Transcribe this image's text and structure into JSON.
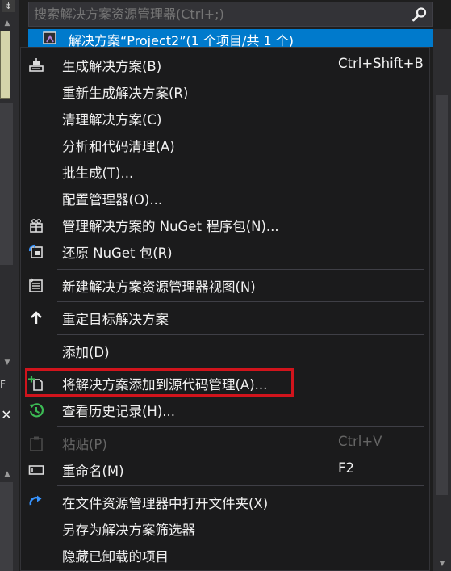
{
  "search": {
    "placeholder": "搜索解决方案资源管理器(Ctrl+;)"
  },
  "solution_row": {
    "label": "解决方案“Project2”(1 个项目/共 1 个)"
  },
  "left_strip": {
    "letter": "F"
  },
  "menu": {
    "items": [
      {
        "label": "生成解决方案(B)",
        "shortcut": "Ctrl+Shift+B",
        "icon": "build-icon"
      },
      {
        "label": "重新生成解决方案(R)",
        "shortcut": "",
        "icon": ""
      },
      {
        "label": "清理解决方案(C)",
        "shortcut": "",
        "icon": ""
      },
      {
        "label": "分析和代码清理(A)",
        "shortcut": "",
        "icon": ""
      },
      {
        "label": "批生成(T)...",
        "shortcut": "",
        "icon": ""
      },
      {
        "label": "配置管理器(O)...",
        "shortcut": "",
        "icon": ""
      },
      {
        "label": "管理解决方案的 NuGet 程序包(N)...",
        "shortcut": "",
        "icon": "nuget-package-icon"
      },
      {
        "label": "还原 NuGet 包(R)",
        "shortcut": "",
        "icon": "restore-package-icon"
      },
      {
        "label": "新建解决方案资源管理器视图(N)",
        "shortcut": "",
        "icon": "new-view-icon"
      },
      {
        "label": "重定目标解决方案",
        "shortcut": "",
        "icon": "up-arrow-icon"
      },
      {
        "label": "添加(D)",
        "shortcut": "",
        "icon": ""
      },
      {
        "label": "将解决方案添加到源代码管理(A)...",
        "shortcut": "",
        "icon": "add-to-source-control-icon"
      },
      {
        "label": "查看历史记录(H)...",
        "shortcut": "",
        "icon": "history-icon"
      },
      {
        "label": "粘贴(P)",
        "shortcut": "Ctrl+V",
        "icon": "paste-icon",
        "disabled": true
      },
      {
        "label": "重命名(M)",
        "shortcut": "F2",
        "icon": "rename-icon"
      },
      {
        "label": "在文件资源管理器中打开文件夹(X)",
        "shortcut": "",
        "icon": "open-folder-icon"
      },
      {
        "label": "另存为解决方案筛选器",
        "shortcut": "",
        "icon": ""
      },
      {
        "label": "隐藏已卸载的项目",
        "shortcut": "",
        "icon": ""
      }
    ]
  },
  "colors": {
    "accent": "#007acc",
    "highlight_border": "#d1141c",
    "menu_bg": "#1b1b1c",
    "history_green": "#3cba54",
    "restore_blue": "#3794ff"
  }
}
